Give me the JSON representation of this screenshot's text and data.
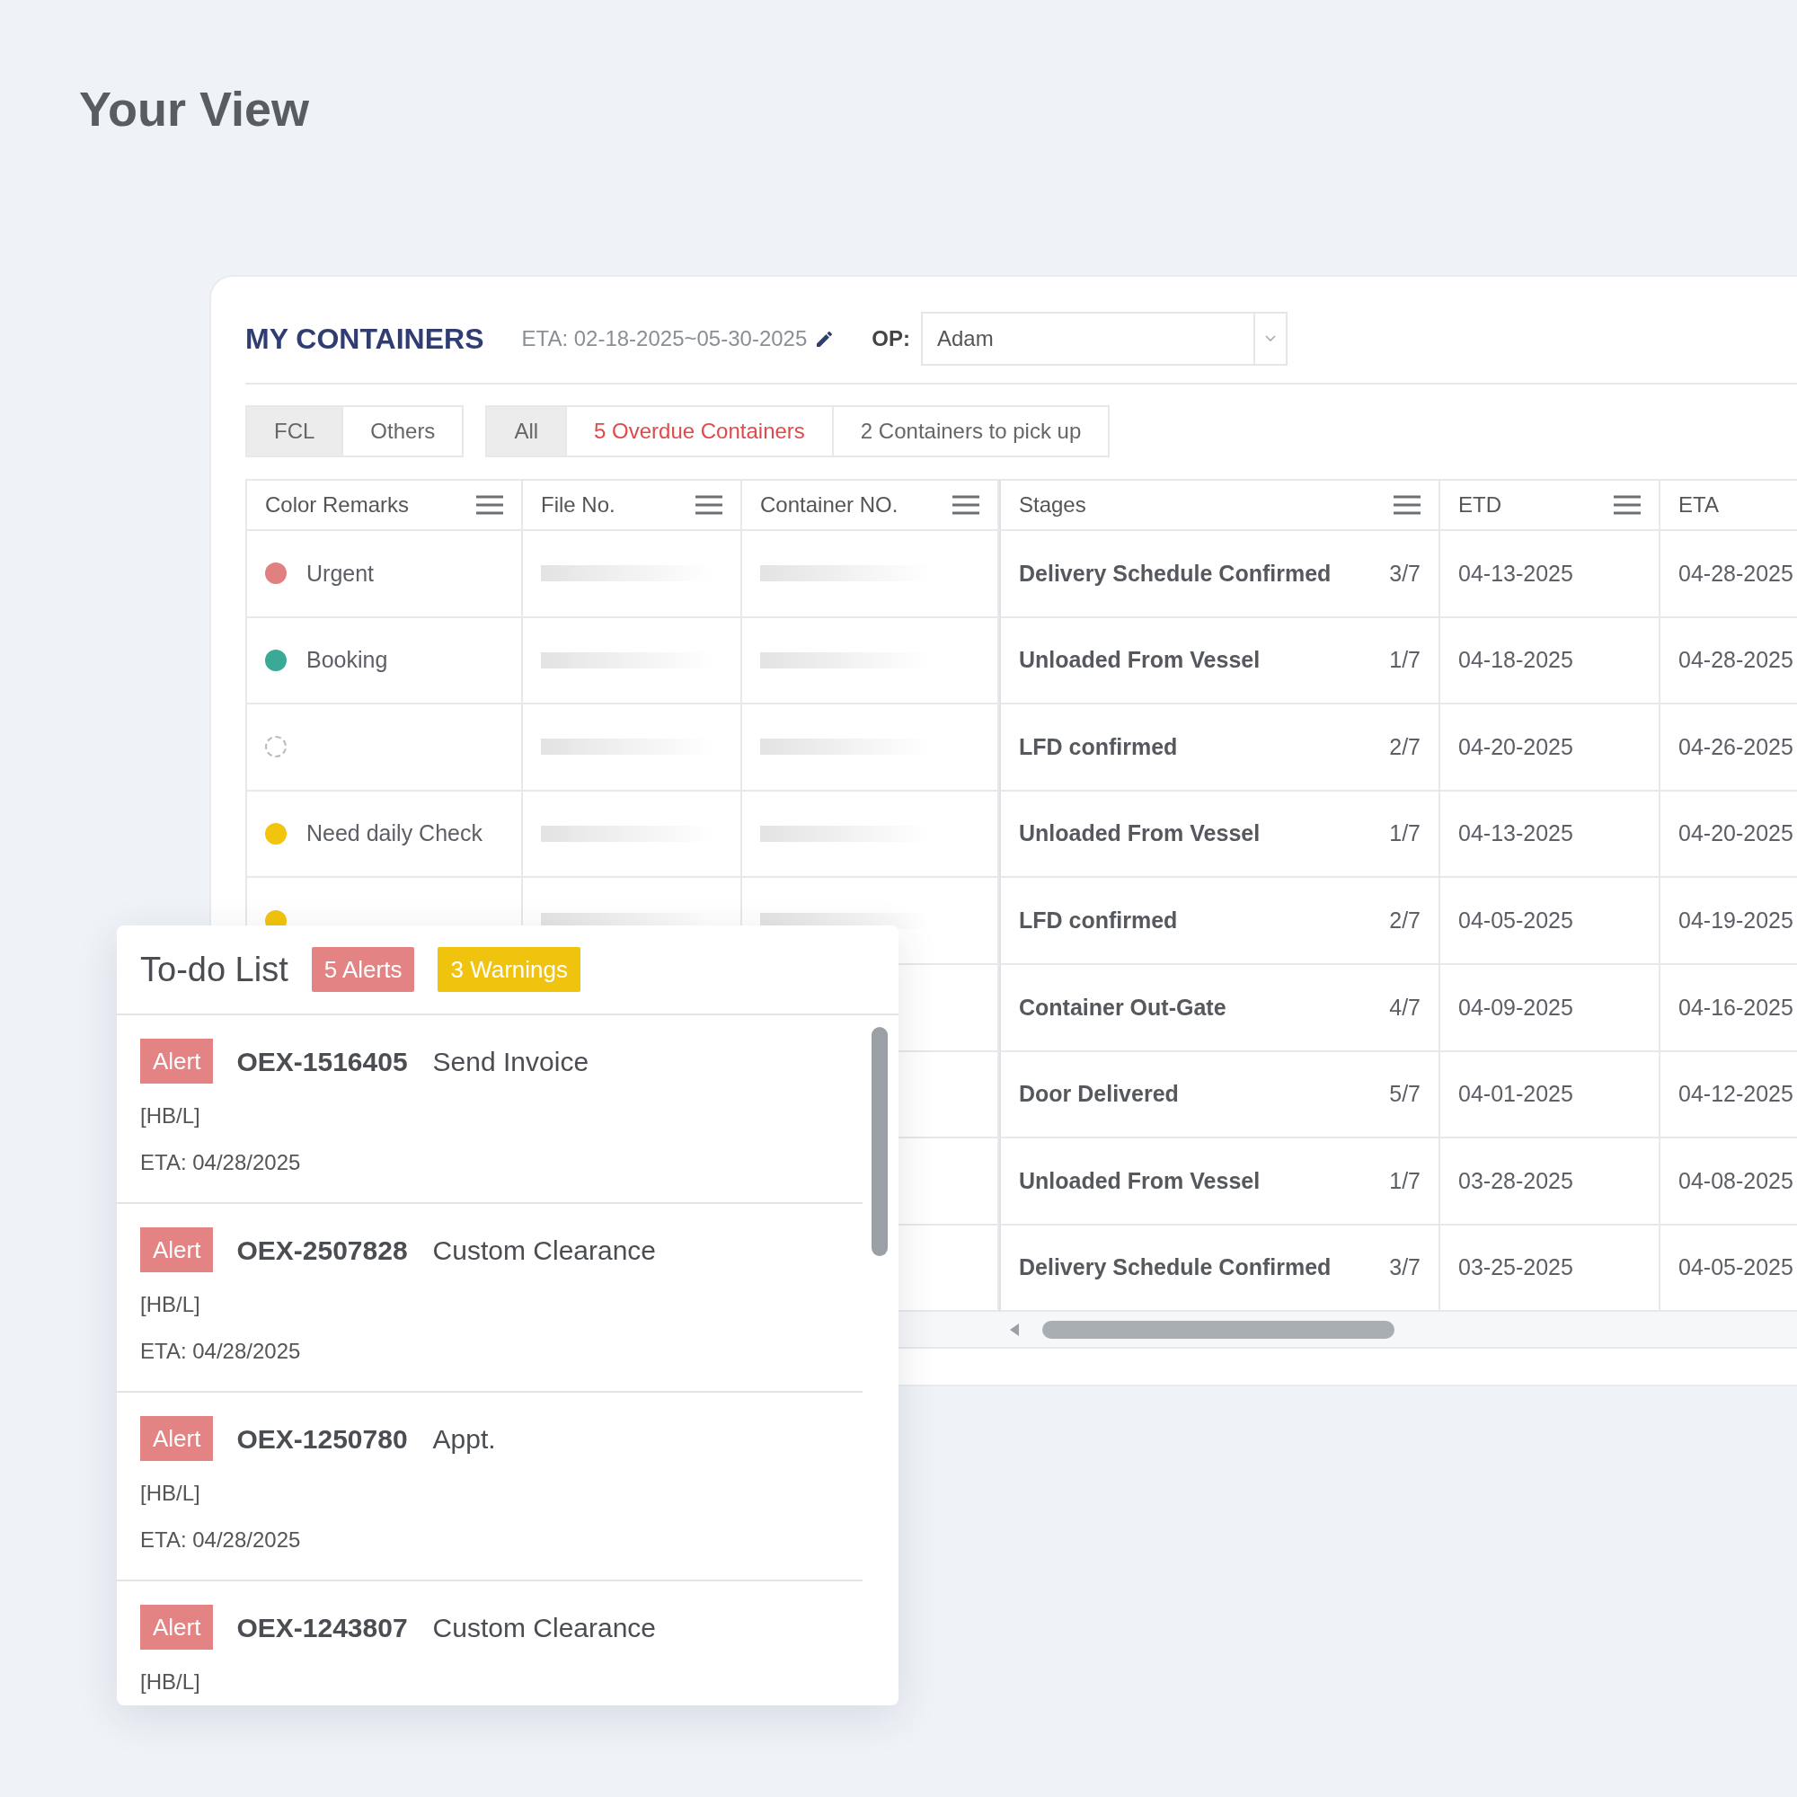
{
  "page_title": "Your View",
  "containers": {
    "title": "MY CONTAINERS",
    "eta_range": "ETA: 02-18-2025~05-30-2025",
    "op_label": "OP:",
    "op_value": "Adam",
    "type_tabs": [
      {
        "label": "FCL",
        "selected": true
      },
      {
        "label": "Others",
        "selected": false
      }
    ],
    "filter_tabs": [
      {
        "label": "All",
        "selected": true,
        "kind": "plain"
      },
      {
        "label": "5 Overdue Containers",
        "selected": false,
        "kind": "alert"
      },
      {
        "label": "2 Containers to pick up",
        "selected": false,
        "kind": "plain"
      }
    ],
    "columns": [
      {
        "label": "Color Remarks",
        "menu": true
      },
      {
        "label": "File No.",
        "menu": true
      },
      {
        "label": "Container NO.",
        "menu": true
      },
      {
        "label": "Stages",
        "menu": true
      },
      {
        "label": "ETD",
        "menu": true
      },
      {
        "label": "ETA"
      }
    ],
    "rows": [
      {
        "color_remark": {
          "kind": "dot",
          "label": "Urgent",
          "color": "#e08080"
        },
        "stage": "Delivery Schedule Confirmed",
        "progress": "3/7",
        "etd": "04-13-2025",
        "eta": "04-28-2025"
      },
      {
        "color_remark": {
          "kind": "dot",
          "label": "Booking",
          "color": "#3aaa97"
        },
        "stage": "Unloaded From Vessel",
        "progress": "1/7",
        "etd": "04-18-2025",
        "eta": "04-28-2025"
      },
      {
        "color_remark": {
          "kind": "none"
        },
        "stage": "LFD confirmed",
        "progress": "2/7",
        "etd": "04-20-2025",
        "eta": "04-26-2025"
      },
      {
        "color_remark": {
          "kind": "dot",
          "label": "Need daily Check",
          "color": "#f2c40c"
        },
        "stage": "Unloaded From Vessel",
        "progress": "1/7",
        "etd": "04-13-2025",
        "eta": "04-20-2025"
      },
      {
        "color_remark": {
          "kind": "dot",
          "color": "#f2c40c"
        },
        "stage": "LFD confirmed",
        "progress": "2/7",
        "etd": "04-05-2025",
        "eta": "04-19-2025"
      },
      {
        "stage": "Container Out-Gate",
        "progress": "4/7",
        "etd": "04-09-2025",
        "eta": "04-16-2025"
      },
      {
        "stage": "Door Delivered",
        "progress": "5/7",
        "etd": "04-01-2025",
        "eta": "04-12-2025"
      },
      {
        "stage": "Unloaded From Vessel",
        "progress": "1/7",
        "etd": "03-28-2025",
        "eta": "04-08-2025"
      },
      {
        "stage": "Delivery Schedule Confirmed",
        "progress": "3/7",
        "etd": "03-25-2025",
        "eta": "04-05-2025"
      }
    ]
  },
  "todo": {
    "title": "To-do List",
    "badges": [
      {
        "label": "5 Alerts",
        "kind": "alert"
      },
      {
        "label": "3 Warnings",
        "kind": "warning"
      }
    ],
    "items": [
      {
        "tag": "Alert",
        "code": "OEX-1516405",
        "task": "Send Invoice",
        "ref": "[HB/L]",
        "eta": "ETA: 04/28/2025"
      },
      {
        "tag": "Alert",
        "code": "OEX-2507828",
        "task": "Custom Clearance",
        "ref": "[HB/L]",
        "eta": "ETA: 04/28/2025"
      },
      {
        "tag": "Alert",
        "code": "OEX-1250780",
        "task": "Appt.",
        "ref": "[HB/L]",
        "eta": "ETA: 04/28/2025"
      },
      {
        "tag": "Alert",
        "code": "OEX-1243807",
        "task": "Custom Clearance",
        "ref": "[HB/L]"
      }
    ]
  }
}
